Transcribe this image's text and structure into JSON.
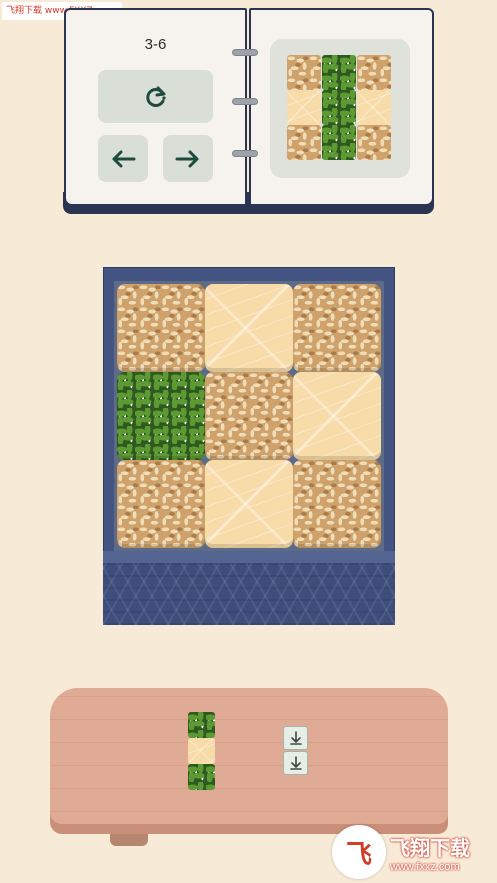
{
  "watermark": {
    "top_text": "飞翔下载 www.FXXZ.com",
    "bottom_brand": "飞翔下载",
    "bottom_url": "www.fxxz.com",
    "logo_glyph": "飞"
  },
  "level": {
    "label": "3-6"
  },
  "controls": {
    "restart_icon": "restart-icon",
    "prev_icon": "arrow-left-icon",
    "next_icon": "arrow-right-icon"
  },
  "preview": {
    "grid": [
      [
        "rice",
        "seaweed",
        "rice"
      ],
      [
        "salmon",
        "seaweed",
        "salmon"
      ],
      [
        "rice",
        "seaweed",
        "rice"
      ]
    ]
  },
  "box": {
    "grid": [
      [
        "rice",
        "salmon",
        "rice"
      ],
      [
        "seaweed",
        "rice",
        "salmon"
      ],
      [
        "rice",
        "salmon",
        "rice"
      ]
    ]
  },
  "tray": {
    "piece": [
      "seaweed",
      "salmon",
      "seaweed"
    ],
    "hint_icons": [
      "arrow-down-icon",
      "arrow-down-icon"
    ]
  },
  "colors": {
    "background": "#f7ead6",
    "button": "#d9ded6",
    "box": "#435483",
    "board": "#e0ab94",
    "rice": "#cfa26b",
    "salmon": "#f7dba8",
    "seaweed": "#2f5a1f"
  }
}
